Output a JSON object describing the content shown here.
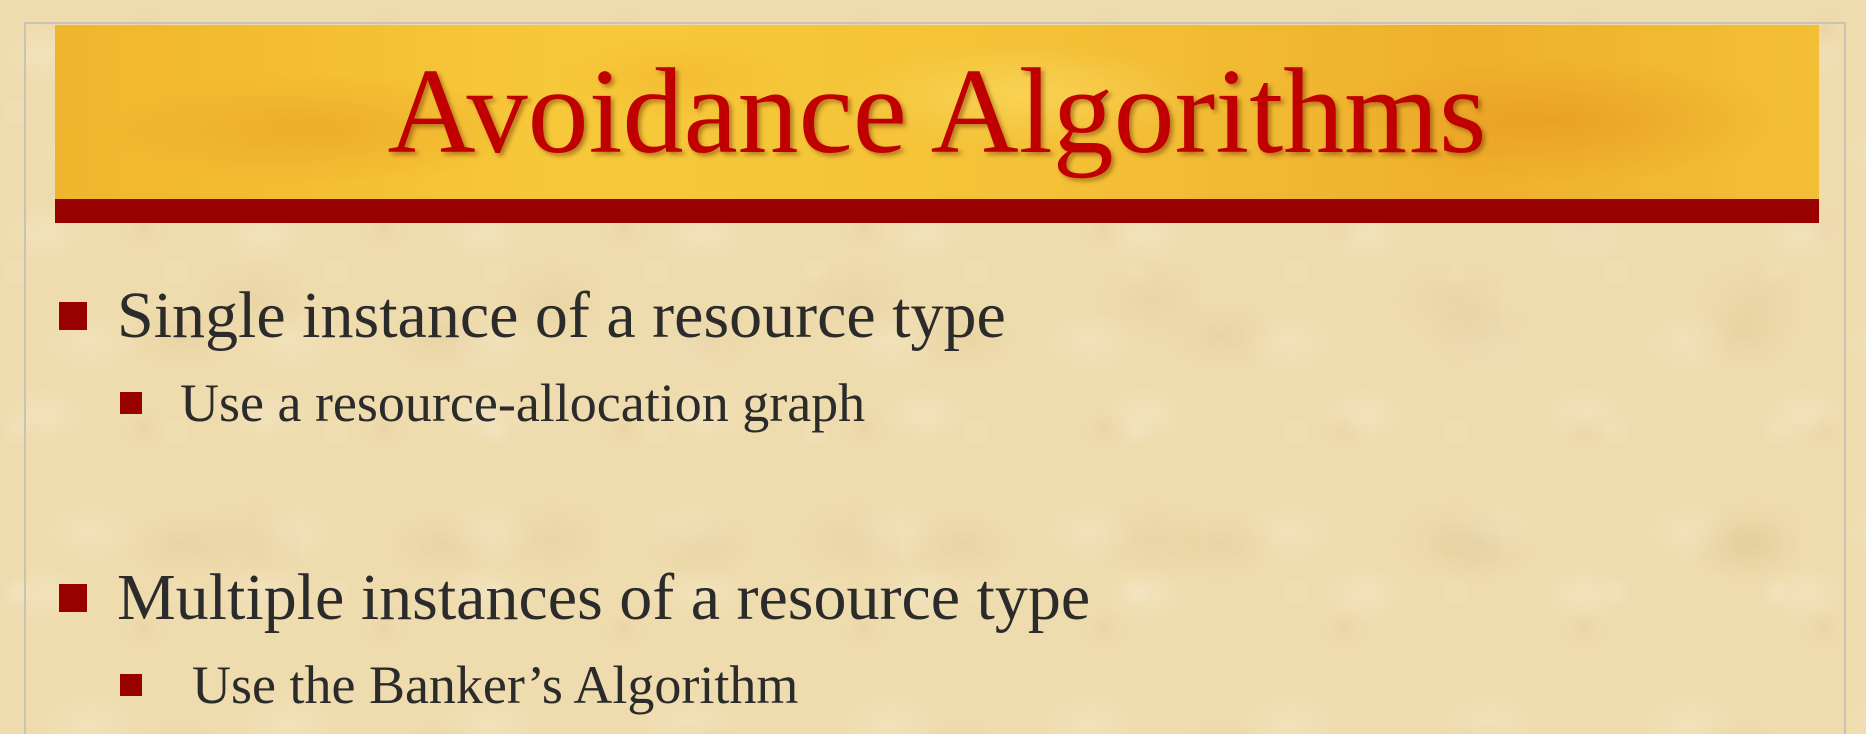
{
  "slide": {
    "title": "Avoidance Algorithms",
    "bullets": [
      {
        "text": "Single instance of a resource type",
        "sub": [
          {
            "text": "Use a resource-allocation graph"
          }
        ]
      },
      {
        "text": "Multiple instances of a resource type",
        "sub": [
          {
            "text": "Use the Banker’s Algorithm"
          }
        ]
      }
    ]
  },
  "colors": {
    "title_text": "#c00000",
    "title_rule": "#990000",
    "bullet_marker": "#990000",
    "body_text": "#2b2b2b",
    "banner_gold": "#f4c238",
    "background": "#efdcae"
  },
  "icons": {
    "bullet": "square-bullet-icon"
  }
}
